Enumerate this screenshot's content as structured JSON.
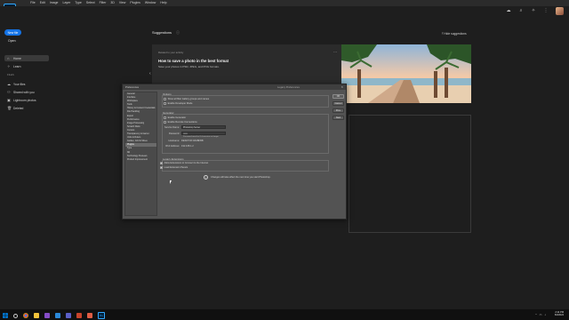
{
  "app": {
    "logo_text": "Ps",
    "menu": [
      "Ps",
      "File",
      "Edit",
      "Image",
      "Layer",
      "Type",
      "Select",
      "Filter",
      "3D",
      "View",
      "Plugins",
      "Window",
      "Help"
    ]
  },
  "top_right": {
    "cloud_icon": "cloud-icon",
    "search_icon": "search-icon",
    "learn_icon": "lightbulb-icon",
    "apps_icon": "grid-icon"
  },
  "sidebar": {
    "new_file": "New file",
    "open": "Open",
    "nav": [
      {
        "label": "Home",
        "icon": "home-icon",
        "active": true
      },
      {
        "label": "Learn",
        "icon": "lightbulb-icon",
        "active": false
      }
    ],
    "files_heading": "FILES",
    "files": [
      {
        "label": "Your files",
        "icon": "cloud-icon"
      },
      {
        "label": "Shared with you",
        "icon": "people-icon"
      },
      {
        "label": "Lightroom photos",
        "icon": "lightroom-icon"
      },
      {
        "label": "Deleted",
        "icon": "trash-icon"
      }
    ]
  },
  "home": {
    "suggestions_title": "Suggestions",
    "hide_suggestions": "Hide suggestions",
    "card": {
      "subtitle": "Related to your activity",
      "title": "How to save a photo in the best format",
      "desc": "Save your photos in PSD, JPEG, and PNG formats.",
      "more": "···"
    }
  },
  "dialog": {
    "title": "Preferences",
    "title_right": "Legacy Preferences",
    "categories": [
      "General",
      "Interface",
      "Workspace",
      "Tools",
      "History & Content Credentials",
      "File Handling",
      "Export",
      "Performance",
      "Image Processing",
      "Scratch Disks",
      "Cursors",
      "Transparency & Gamut",
      "Units & Rulers",
      "Guides, Grid & Slices",
      "Plugins",
      "Type",
      "3D",
      "Technology Previews",
      "Product Improvement"
    ],
    "selected_category": "Plugins",
    "buttons": {
      "ok": "OK",
      "cancel": "Cancel",
      "prev": "Prev",
      "next": "Next"
    },
    "options_label": "Options",
    "options": [
      {
        "label": "Show all filter Gallery groups and names",
        "checked": false
      },
      {
        "label": "Enable Developer Mode",
        "checked": false
      }
    ],
    "generator_label": "Generator",
    "generator": [
      {
        "label": "Enable Generator",
        "checked": false
      },
      {
        "label": "Enable Remote Connections",
        "checked": false
      }
    ],
    "fields": [
      {
        "label": "Service Name:",
        "value": "Photoshop Server"
      },
      {
        "label": "Password:",
        "value": "••••••"
      },
      {
        "label": "Hostname:",
        "value": "DESKTOP-8A6BFBB"
      },
      {
        "label": "IPv4 Address:",
        "value": "192.168.1.2"
      }
    ],
    "password_note": "Password must be 6 characters or longer",
    "legacy_label": "Legacy Extensions",
    "legacy": [
      {
        "label": "Allow Extensions to Connect to the Internet",
        "checked": true
      },
      {
        "label": "Load Extension Panels",
        "checked": true
      }
    ],
    "info_text": "Changes will take effect the next time you start Photoshop."
  },
  "taskbar": {
    "time": "2:14 PM",
    "date": "6/3/2024",
    "apps": [
      "windows-icon",
      "search-icon",
      "chrome-icon",
      "explorer-icon",
      "vs-icon",
      "vs-code-icon",
      "teams-icon",
      "app-icon",
      "git-icon",
      "photoshop-icon"
    ],
    "ps_label": "Ps"
  },
  "colors": {
    "accent": "#1473e6",
    "ps_blue": "#31a8ff",
    "background": "#1e1e1e"
  }
}
